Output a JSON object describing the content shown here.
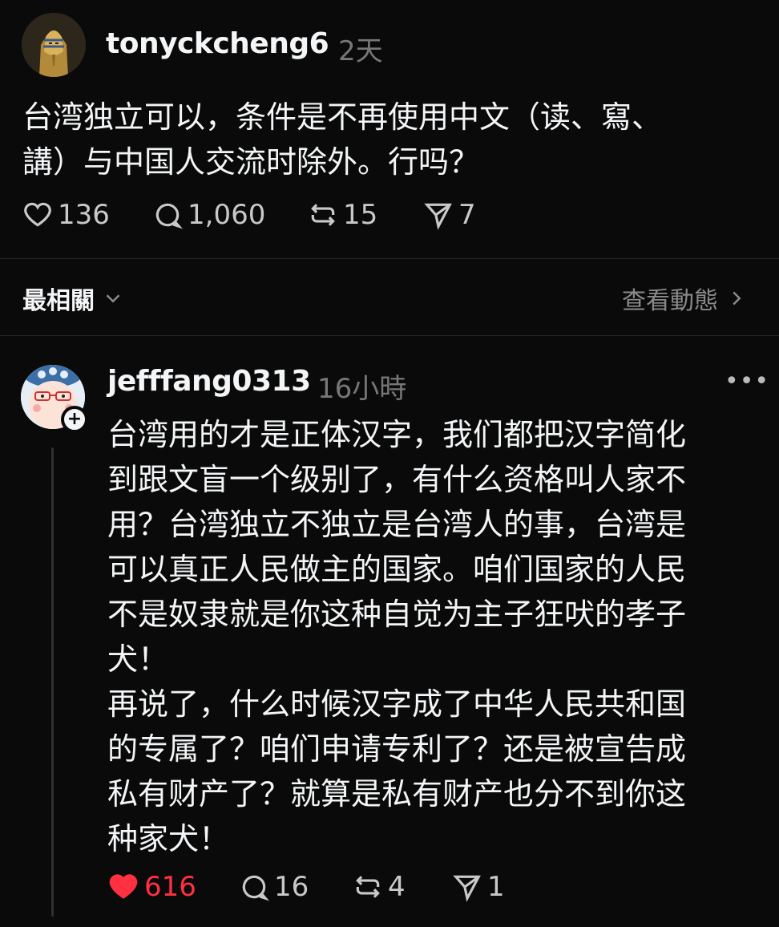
{
  "post": {
    "username": "tonyckcheng6",
    "time": "2天",
    "text_lines": [
      "台湾独立可以，条件是不再使用中文（读、寫、",
      "講）与中国人交流时除外。行吗？"
    ],
    "likes": "136",
    "comments": "1,060",
    "reposts": "15",
    "shares": "7"
  },
  "filter": {
    "label": "最相關",
    "activity_label": "查看動態"
  },
  "reply": {
    "username": "jefffang0313",
    "time": "16小時",
    "text_lines": [
      "台湾用的才是正体汉字，我们都把汉字简化",
      "到跟文盲一个级别了，有什么资格叫人家不",
      "用？台湾独立不独立是台湾人的事，台湾是",
      "可以真正人民做主的国家。咱们国家的人民",
      "不是奴隶就是你这种自觉为主子狂吠的孝子",
      "犬！",
      "再说了，什么时候汉字成了中华人民共和国",
      "的专属了？咱们申请专利了？还是被宣告成",
      "私有财产了？就算是私有财产也分不到你这",
      "种家犬！"
    ],
    "likes": "616",
    "comments": "16",
    "reposts": "4",
    "shares": "1",
    "liked": true
  },
  "colors": {
    "background": "#0a0a0a",
    "text": "#f3f5f7",
    "muted": "#777777",
    "like_active": "#ff3040"
  }
}
